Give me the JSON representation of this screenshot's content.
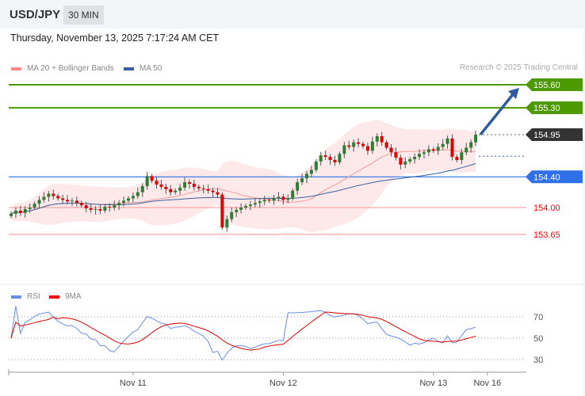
{
  "header": {
    "symbol": "USD/JPY",
    "timeframe": "30 MIN"
  },
  "datetime": "Thursday, November 13, 2025 7:17:24 AM CET",
  "legend": {
    "ma20": "MA 20 + Bollinger Bands",
    "ma50": "MA 50",
    "rsi": "RSI",
    "ma9": "9MA"
  },
  "copyright": "Research © 2025 Trading Central",
  "colors": {
    "up": "#2e7d32",
    "down": "#e00000",
    "ma20": "#f08080",
    "ma50": "#3a5f9e",
    "resistance": "#4c9a00",
    "pivot": "#2f6fe8",
    "support": "#f00",
    "current": "#333",
    "rsi": "#6a8de8",
    "ma9": "#e00000"
  },
  "chart_data": {
    "type": "candlestick",
    "levels": [
      {
        "value": 155.6,
        "label": "155.60",
        "kind": "resistance"
      },
      {
        "value": 155.3,
        "label": "155.30",
        "kind": "resistance"
      },
      {
        "value": 154.95,
        "label": "154.95",
        "kind": "current"
      },
      {
        "value": 154.4,
        "label": "154.40",
        "kind": "pivot"
      },
      {
        "value": 154.0,
        "label": "154.00",
        "kind": "support"
      },
      {
        "value": 153.65,
        "label": "153.65",
        "kind": "support"
      }
    ],
    "closes": [
      153.92,
      153.96,
      153.93,
      153.98,
      154.0,
      154.05,
      154.1,
      154.14,
      154.18,
      154.15,
      154.12,
      154.1,
      154.08,
      154.09,
      154.06,
      154.03,
      153.99,
      153.97,
      153.98,
      153.96,
      154.01,
      154.0,
      154.03,
      154.06,
      154.09,
      154.12,
      154.15,
      154.2,
      154.28,
      154.41,
      154.35,
      154.3,
      154.27,
      154.24,
      154.2,
      154.22,
      154.26,
      154.33,
      154.31,
      154.27,
      154.25,
      154.24,
      154.22,
      154.2,
      154.17,
      153.74,
      153.85,
      153.94,
      153.97,
      154.0,
      154.02,
      154.04,
      154.06,
      154.08,
      154.1,
      154.09,
      154.12,
      154.14,
      154.1,
      154.12,
      154.22,
      154.33,
      154.38,
      154.44,
      154.49,
      154.6,
      154.68,
      154.66,
      154.62,
      154.59,
      154.7,
      154.81,
      154.79,
      154.85,
      154.83,
      154.8,
      154.74,
      154.86,
      154.93,
      154.85,
      154.78,
      154.72,
      154.65,
      154.56,
      154.6,
      154.63,
      154.66,
      154.7,
      154.72,
      154.76,
      154.74,
      154.79,
      154.83,
      154.9,
      154.66,
      154.62,
      154.72,
      154.78,
      154.85,
      154.95
    ],
    "target": 155.6,
    "x_ticks": [
      {
        "label": "Nov 11",
        "index": 26
      },
      {
        "label": "Nov 12",
        "index": 58
      },
      {
        "label": "Nov 13",
        "index": 90
      },
      {
        "label": "Nov 16",
        "index": 101.5
      }
    ],
    "rsi_ticks": [
      70,
      50,
      30
    ],
    "rsi_range": [
      20,
      80
    ]
  }
}
